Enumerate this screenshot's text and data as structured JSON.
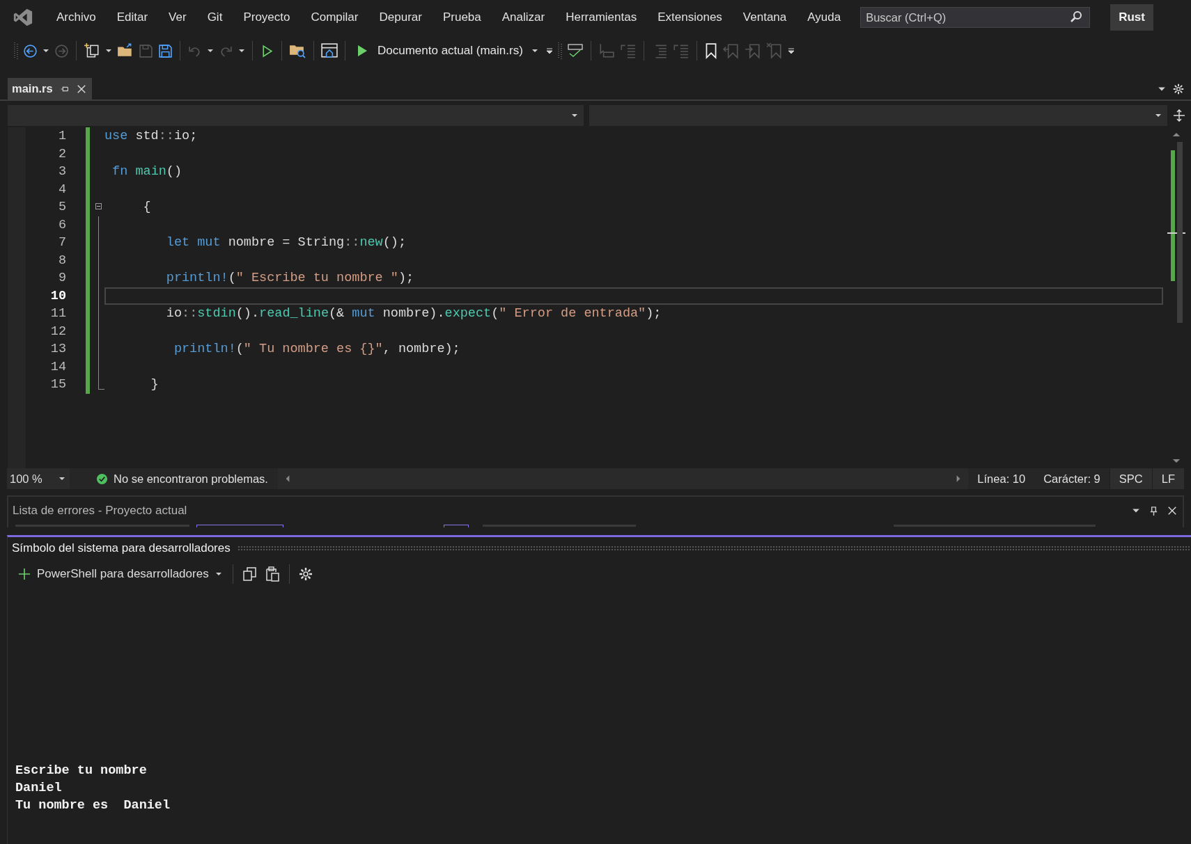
{
  "menu": [
    "Archivo",
    "Editar",
    "Ver",
    "Git",
    "Proyecto",
    "Compilar",
    "Depurar",
    "Prueba",
    "Analizar",
    "Herramientas",
    "Extensiones",
    "Ventana",
    "Ayuda"
  ],
  "search": {
    "placeholder": "Buscar (Ctrl+Q)"
  },
  "solution_name": "Rust",
  "toolbar": {
    "run_target": "Documento actual (main.rs)"
  },
  "tabs": [
    {
      "label": "main.rs",
      "selected": true
    }
  ],
  "editor": {
    "lines": [
      {
        "number": "1",
        "current": false,
        "modified": true,
        "collapsible": false,
        "in_block": false,
        "tokens": [
          {
            "kind": "keyword",
            "text": "use"
          },
          {
            "kind": "plain",
            "text": " std"
          },
          {
            "kind": "punct",
            "text": "::"
          },
          {
            "kind": "plain",
            "text": "io;"
          }
        ]
      },
      {
        "number": "2",
        "current": false,
        "modified": true,
        "collapsible": false,
        "in_block": false
      },
      {
        "number": "3",
        "current": false,
        "modified": true,
        "collapsible": false,
        "in_block": false,
        "tokens": [
          {
            "kind": "keyword",
            "text": " fn "
          },
          {
            "kind": "function",
            "text": "main"
          },
          {
            "kind": "plain",
            "text": "()"
          }
        ]
      },
      {
        "number": "4",
        "current": false,
        "modified": true,
        "collapsible": false,
        "in_block": false
      },
      {
        "number": "5",
        "current": false,
        "modified": true,
        "collapsible": true,
        "in_block": false,
        "tokens": [
          {
            "kind": "plain",
            "text": "     {"
          }
        ]
      },
      {
        "number": "6",
        "current": false,
        "modified": true,
        "collapsible": false,
        "in_block": true
      },
      {
        "number": "7",
        "current": false,
        "modified": true,
        "collapsible": false,
        "in_block": true,
        "tokens": [
          {
            "kind": "keyword",
            "text": "        let mut"
          },
          {
            "kind": "plain",
            "text": " nombre = String"
          },
          {
            "kind": "punct",
            "text": "::"
          },
          {
            "kind": "function",
            "text": "new"
          },
          {
            "kind": "plain",
            "text": "();"
          }
        ]
      },
      {
        "number": "8",
        "current": false,
        "modified": true,
        "collapsible": false,
        "in_block": true
      },
      {
        "number": "9",
        "current": false,
        "modified": true,
        "collapsible": false,
        "in_block": true,
        "tokens": [
          {
            "kind": "macro",
            "text": "        println!"
          },
          {
            "kind": "plain",
            "text": "("
          },
          {
            "kind": "string",
            "text": "\" Escribe tu nombre \""
          },
          {
            "kind": "plain",
            "text": ");"
          }
        ]
      },
      {
        "number": "10",
        "current": true,
        "modified": true,
        "collapsible": false,
        "in_block": true
      },
      {
        "number": "11",
        "current": false,
        "modified": true,
        "collapsible": false,
        "in_block": true,
        "tokens": [
          {
            "kind": "plain",
            "text": "        io"
          },
          {
            "kind": "punct",
            "text": "::"
          },
          {
            "kind": "function",
            "text": "stdin"
          },
          {
            "kind": "plain",
            "text": "()."
          },
          {
            "kind": "function",
            "text": "read_line"
          },
          {
            "kind": "plain",
            "text": "(& "
          },
          {
            "kind": "keyword",
            "text": "mut"
          },
          {
            "kind": "plain",
            "text": " nombre)."
          },
          {
            "kind": "function",
            "text": "expect"
          },
          {
            "kind": "plain",
            "text": "("
          },
          {
            "kind": "string",
            "text": "\" Error de entrada\""
          },
          {
            "kind": "plain",
            "text": ");"
          }
        ]
      },
      {
        "number": "12",
        "current": false,
        "modified": true,
        "collapsible": false,
        "in_block": true
      },
      {
        "number": "13",
        "current": false,
        "modified": true,
        "collapsible": false,
        "in_block": true,
        "tokens": [
          {
            "kind": "macro",
            "text": "         println!"
          },
          {
            "kind": "plain",
            "text": "("
          },
          {
            "kind": "string",
            "text": "\" Tu nombre es {}\""
          },
          {
            "kind": "plain",
            "text": ", nombre);"
          }
        ]
      },
      {
        "number": "14",
        "current": false,
        "modified": true,
        "collapsible": false,
        "in_block": true
      },
      {
        "number": "15",
        "current": false,
        "modified": true,
        "collapsible": false,
        "in_block": true,
        "tokens": [
          {
            "kind": "plain",
            "text": "      }"
          }
        ]
      }
    ]
  },
  "status": {
    "zoom": "100 %",
    "problems": "No se encontraron problemas.",
    "line": "Línea: 10",
    "column": "Carácter: 9",
    "indent": "SPC",
    "eol": "LF"
  },
  "error_list": {
    "title": "Lista de errores - Proyecto actual"
  },
  "terminal": {
    "title": "Símbolo del sistema para desarrolladores",
    "profile": "PowerShell para desarrolladores",
    "output": [
      "Escribe tu nombre",
      "Daniel",
      "Tu nombre es  Daniel"
    ]
  }
}
